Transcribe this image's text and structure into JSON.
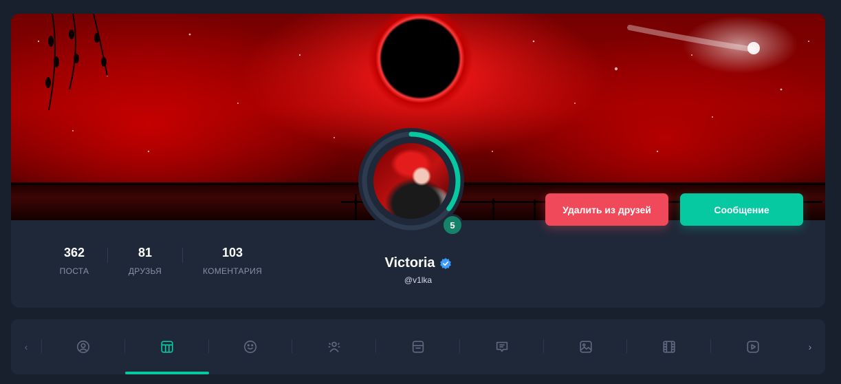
{
  "profile": {
    "display_name": "Victoria",
    "username": "@v1lka",
    "level": "5",
    "verified": true
  },
  "stats": [
    {
      "value": "362",
      "label": "ПОСТА"
    },
    {
      "value": "81",
      "label": "ДРУЗЬЯ"
    },
    {
      "value": "103",
      "label": "КОМЕНТАРИЯ"
    }
  ],
  "actions": {
    "remove_friend_label": "Удалить из друзей",
    "message_label": "Сообщение"
  },
  "tabs": [
    {
      "icon": "user-circle-icon",
      "active": false
    },
    {
      "icon": "layout-icon",
      "active": true
    },
    {
      "icon": "smiley-icon",
      "active": false
    },
    {
      "icon": "friends-icon",
      "active": false
    },
    {
      "icon": "card-icon",
      "active": false
    },
    {
      "icon": "comment-icon",
      "active": false
    },
    {
      "icon": "image-icon",
      "active": false
    },
    {
      "icon": "film-icon",
      "active": false
    },
    {
      "icon": "video-play-icon",
      "active": false
    }
  ],
  "colors": {
    "background": "#18202e",
    "card": "#1f2839",
    "accent_teal": "#06c9a2",
    "danger_red": "#f04a5a",
    "muted_text": "#8792a8"
  }
}
